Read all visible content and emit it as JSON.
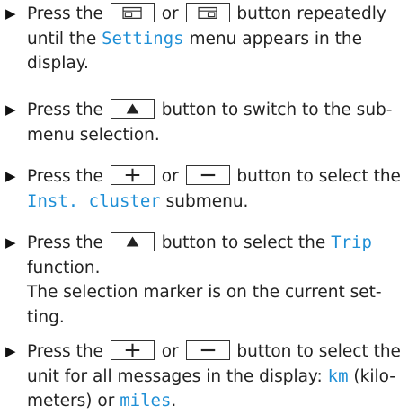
{
  "steps": [
    {
      "marker": "▶",
      "lines": [
        {
          "parts": [
            {
              "t": "text",
              "v": "Press the "
            },
            {
              "t": "btn",
              "icon": "display-left-icon"
            },
            {
              "t": "text",
              "v": " or "
            },
            {
              "t": "btn",
              "icon": "display-right-icon"
            },
            {
              "t": "text",
              "v": " button repeatedly"
            }
          ]
        },
        {
          "parts": [
            {
              "t": "text",
              "v": "until the "
            },
            {
              "t": "hl",
              "v": "Settings"
            },
            {
              "t": "text",
              "v": " menu appears in the"
            }
          ]
        },
        {
          "parts": [
            {
              "t": "text",
              "v": "display."
            }
          ]
        }
      ]
    },
    {
      "marker": "▶",
      "lines": [
        {
          "parts": [
            {
              "t": "text",
              "v": "Press the "
            },
            {
              "t": "btn",
              "icon": "up-triangle-icon"
            },
            {
              "t": "text",
              "v": " button to switch to the sub-"
            }
          ]
        },
        {
          "parts": [
            {
              "t": "text",
              "v": "menu selection."
            }
          ]
        }
      ]
    },
    {
      "marker": "▶",
      "lines": [
        {
          "parts": [
            {
              "t": "text",
              "v": "Press the "
            },
            {
              "t": "btn",
              "icon": "plus-icon"
            },
            {
              "t": "text",
              "v": " or "
            },
            {
              "t": "btn",
              "icon": "minus-icon"
            },
            {
              "t": "text",
              "v": " button to select the"
            }
          ]
        },
        {
          "parts": [
            {
              "t": "hl",
              "v": "Inst. cluster"
            },
            {
              "t": "text",
              "v": " submenu."
            }
          ]
        }
      ]
    },
    {
      "marker": "▶",
      "lines": [
        {
          "parts": [
            {
              "t": "text",
              "v": "Press the "
            },
            {
              "t": "btn",
              "icon": "up-triangle-icon"
            },
            {
              "t": "text",
              "v": " button to select the "
            },
            {
              "t": "hl",
              "v": "Trip"
            }
          ]
        },
        {
          "parts": [
            {
              "t": "text",
              "v": "function."
            }
          ]
        },
        {
          "parts": [
            {
              "t": "text",
              "v": "The selection marker is on the current set-"
            }
          ]
        },
        {
          "parts": [
            {
              "t": "text",
              "v": "ting."
            }
          ]
        }
      ]
    },
    {
      "marker": "▶",
      "lines": [
        {
          "parts": [
            {
              "t": "text",
              "v": "Press the "
            },
            {
              "t": "btn",
              "icon": "plus-icon"
            },
            {
              "t": "text",
              "v": " or "
            },
            {
              "t": "btn",
              "icon": "minus-icon"
            },
            {
              "t": "text",
              "v": " button to select the"
            }
          ]
        },
        {
          "parts": [
            {
              "t": "text",
              "v": "unit for all messages in the display: "
            },
            {
              "t": "hl",
              "v": "km"
            },
            {
              "t": "text",
              "v": " (kilo-"
            }
          ]
        },
        {
          "parts": [
            {
              "t": "text",
              "v": "meters) or "
            },
            {
              "t": "hl",
              "v": "miles"
            },
            {
              "t": "text",
              "v": "."
            }
          ]
        }
      ]
    }
  ]
}
